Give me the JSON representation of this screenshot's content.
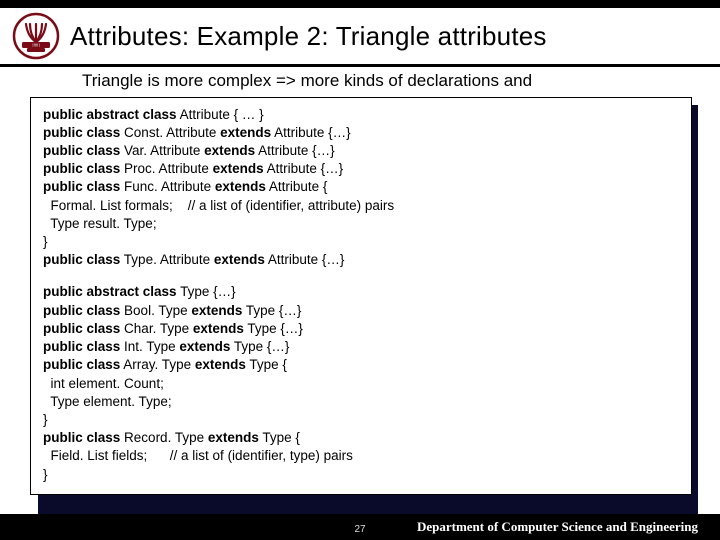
{
  "header": {
    "title": "Attributes: Example 2: Triangle attributes",
    "subtitle": "Triangle is more complex => more kinds of declarations and"
  },
  "code_block1": [
    [
      [
        "public abstract class",
        "kw"
      ],
      [
        " Attribute { … }",
        "n"
      ]
    ],
    [
      [
        "public class",
        "kw"
      ],
      [
        " Const. Attribute ",
        "n"
      ],
      [
        "extends",
        "kw"
      ],
      [
        " Attribute {…}",
        "n"
      ]
    ],
    [
      [
        "public class",
        "kw"
      ],
      [
        " Var. Attribute ",
        "n"
      ],
      [
        "extends",
        "kw"
      ],
      [
        " Attribute {…}",
        "n"
      ]
    ],
    [
      [
        "public class",
        "kw"
      ],
      [
        " Proc. Attribute ",
        "n"
      ],
      [
        "extends",
        "kw"
      ],
      [
        " Attribute {…}",
        "n"
      ]
    ],
    [
      [
        "public class",
        "kw"
      ],
      [
        " Func. Attribute ",
        "n"
      ],
      [
        "extends",
        "kw"
      ],
      [
        " Attribute {",
        "n"
      ]
    ],
    [
      [
        "  Formal. List formals;    // a list of (identifier, attribute) pairs",
        "n"
      ]
    ],
    [
      [
        "  Type result. Type;",
        "n"
      ]
    ],
    [
      [
        "}",
        "n"
      ]
    ],
    [
      [
        "public class",
        "kw"
      ],
      [
        " Type. Attribute ",
        "n"
      ],
      [
        "extends",
        "kw"
      ],
      [
        " Attribute {…}",
        "n"
      ]
    ]
  ],
  "code_block2": [
    [
      [
        "public abstract class",
        "kw"
      ],
      [
        " Type {…}",
        "n"
      ]
    ],
    [
      [
        "public class",
        "kw"
      ],
      [
        " Bool. Type ",
        "n"
      ],
      [
        "extends",
        "kw"
      ],
      [
        " Type {…}",
        "n"
      ]
    ],
    [
      [
        "public class",
        "kw"
      ],
      [
        " Char. Type ",
        "n"
      ],
      [
        "extends",
        "kw"
      ],
      [
        " Type {…}",
        "n"
      ]
    ],
    [
      [
        "public class",
        "kw"
      ],
      [
        " Int. Type ",
        "n"
      ],
      [
        "extends",
        "kw"
      ],
      [
        " Type {…}",
        "n"
      ]
    ],
    [
      [
        "public class",
        "kw"
      ],
      [
        " Array. Type ",
        "n"
      ],
      [
        "extends",
        "kw"
      ],
      [
        " Type {",
        "n"
      ]
    ],
    [
      [
        "  int element. Count;",
        "n"
      ]
    ],
    [
      [
        "  Type element. Type;",
        "n"
      ]
    ],
    [
      [
        "}",
        "n"
      ]
    ],
    [
      [
        "public class",
        "kw"
      ],
      [
        " Record. Type ",
        "n"
      ],
      [
        "extends",
        "kw"
      ],
      [
        " Type {",
        "n"
      ]
    ],
    [
      [
        "  Field. List fields;      // a list of (identifier, type) pairs",
        "n"
      ]
    ],
    [
      [
        "}",
        "n"
      ]
    ]
  ],
  "footer": {
    "dept": "Department of Computer Science and Engineering",
    "page": "27"
  },
  "logo_colors": {
    "bg": "#fff",
    "stroke": "#7a0c17"
  }
}
